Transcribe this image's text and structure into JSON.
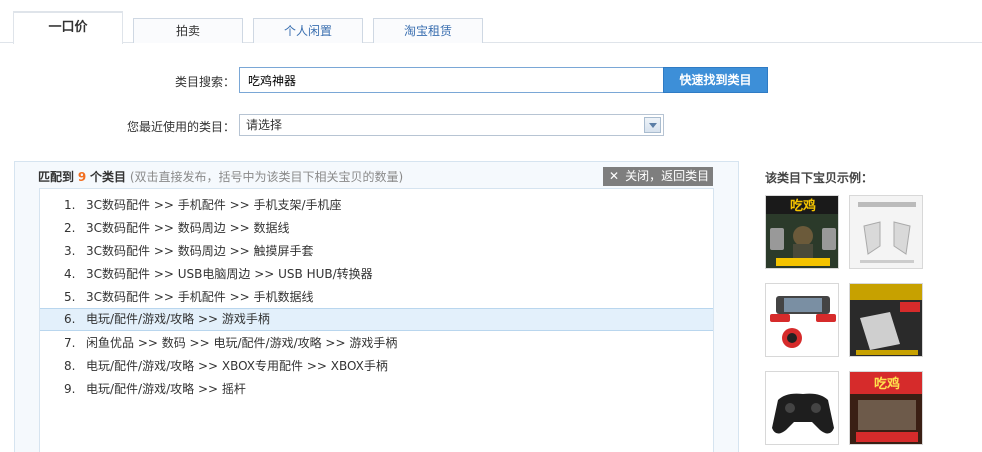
{
  "tabs": [
    {
      "label": "一口价",
      "active": true
    },
    {
      "label": "拍卖",
      "active": false
    },
    {
      "label": "个人闲置",
      "active": false
    },
    {
      "label": "淘宝租赁",
      "active": false
    }
  ],
  "search": {
    "label": "类目搜索：",
    "value": "吃鸡神器",
    "button": "快速找到类目"
  },
  "recent": {
    "label": "您最近使用的类目：",
    "selected": "请选择"
  },
  "results": {
    "prefix": "匹配到",
    "count": "9",
    "suffix": "个类目",
    "hint": "(双击直接发布，括号中为该类目下相关宝贝的数量)",
    "close_label": "关闭，返回类目",
    "items": [
      {
        "num": "1.",
        "text": "3C数码配件 >> 手机配件 >> 手机支架/手机座"
      },
      {
        "num": "2.",
        "text": "3C数码配件 >> 数码周边 >> 数据线"
      },
      {
        "num": "3.",
        "text": "3C数码配件 >> 数码周边 >> 触摸屏手套"
      },
      {
        "num": "4.",
        "text": "3C数码配件 >> USB电脑周边 >> USB HUB/转换器"
      },
      {
        "num": "5.",
        "text": "3C数码配件 >> 手机配件 >> 手机数据线"
      },
      {
        "num": "6.",
        "text": "电玩/配件/游戏/攻略 >> 游戏手柄"
      },
      {
        "num": "7.",
        "text": "闲鱼优品 >> 数码 >> 电玩/配件/游戏/攻略 >> 游戏手柄"
      },
      {
        "num": "8.",
        "text": "电玩/配件/游戏/攻略 >> XBOX专用配件 >> XBOX手柄"
      },
      {
        "num": "9.",
        "text": "电玩/配件/游戏/攻略 >> 摇杆"
      }
    ],
    "selected_index": 5
  },
  "examples": {
    "title": "该类目下宝贝示例：",
    "banner_text": "吃鸡",
    "colors": {
      "accent": "#3d8fd8",
      "orange": "#f26f21",
      "red": "#d62b2b"
    }
  }
}
